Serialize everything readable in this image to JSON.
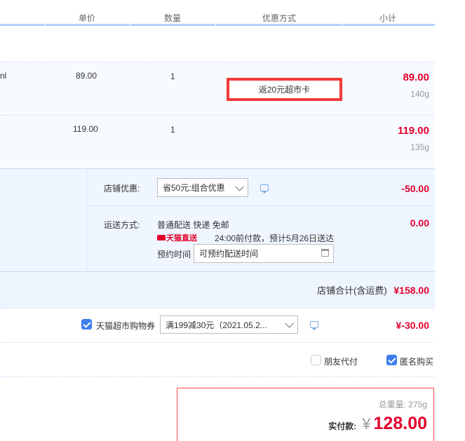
{
  "header": {
    "col_price": "单价",
    "col_qty": "数量",
    "col_promo": "优惠方式",
    "col_subtotal": "小计"
  },
  "items": [
    {
      "title_fragment": "nl",
      "price": "89.00",
      "qty": "1",
      "promo": "返20元超市卡",
      "subtotal": "89.00",
      "weight": "140g"
    },
    {
      "price": "119.00",
      "qty": "1",
      "subtotal": "119.00",
      "weight": "135g"
    }
  ],
  "shop": {
    "discount_label": "店铺优惠:",
    "discount_select": "省50元:组合优惠",
    "discount_amount": "-50.00",
    "delivery_label": "运送方式:",
    "delivery_method": "普通配送 快递 免邮",
    "tmall_direct": "天猫直送",
    "delivery_note": "24:00前付款，预计5月26日送达",
    "reserve_label": "预约时间",
    "reserve_placeholder": "可预约配送时间",
    "delivery_amount": "0.00",
    "total_label": "店铺合计(含运费)",
    "total_amount": "¥158.00"
  },
  "coupon": {
    "label": "天猫超市购物券",
    "checked": true,
    "select": "满199减30元（2021.05.2...",
    "amount": "¥-30.00"
  },
  "options": {
    "friend_pay": "朋友代付",
    "friend_pay_checked": false,
    "anonymous": "匿名购买",
    "anonymous_checked": true
  },
  "summary": {
    "weight_label": "总重量:",
    "weight_value": "275g",
    "pay_label": "实付款:",
    "currency": "¥",
    "pay_amount": "128.00"
  },
  "colors": {
    "accent_red": "#e4002b",
    "header_blue": "#b2d1ff",
    "row_bg": "#f7faff",
    "checkbox_blue": "#3d7df0"
  }
}
